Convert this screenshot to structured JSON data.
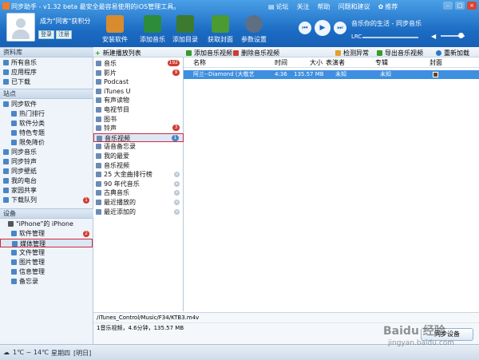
{
  "window": {
    "title": "同步助手 - v1.32 beta  最安全最容易使用的iOS管理工具。",
    "top_links": [
      "论坛",
      "关注",
      "帮助",
      "问题和建议",
      "推荐"
    ]
  },
  "user": {
    "slogan": "成为\"同客\"获积分",
    "login_label": "登录",
    "register_label": "注册"
  },
  "toolbar": {
    "buttons": [
      {
        "label": "安装软件",
        "icon": "install-software-icon",
        "color": "#d88b2f"
      },
      {
        "label": "添加音乐",
        "icon": "add-music-icon",
        "color": "#2d8c3a"
      },
      {
        "label": "添加目录",
        "icon": "add-folder-icon",
        "color": "#3b7a2f"
      },
      {
        "label": "获取封面",
        "icon": "get-cover-icon",
        "color": "#4b9a32"
      },
      {
        "label": "参数设置",
        "icon": "settings-icon",
        "color": "#5e6f83"
      }
    ]
  },
  "player": {
    "prev": "⏮",
    "play": "▶",
    "next": "⏭",
    "song": "音乐你的生活 - 同步音乐",
    "lrc_label": "LRC",
    "volume_icon": "speaker-icon"
  },
  "sidebar": {
    "library_head": "资料库",
    "library_items": [
      {
        "label": "所有音乐",
        "icon": "music-icon"
      },
      {
        "label": "应用程序",
        "icon": "app-icon"
      },
      {
        "label": "已下载",
        "icon": "download-icon"
      }
    ],
    "site_head": "站点",
    "site_items": [
      {
        "label": "同步软件",
        "icon": "software-icon",
        "level": 0
      },
      {
        "label": "热门排行",
        "icon": "rank-icon",
        "level": 1
      },
      {
        "label": "软件分类",
        "icon": "category-icon",
        "level": 1
      },
      {
        "label": "特色专题",
        "icon": "topic-icon",
        "level": 1
      },
      {
        "label": "限免降价",
        "icon": "discount-icon",
        "level": 1
      },
      {
        "label": "同步音乐",
        "icon": "music-icon",
        "level": 0
      },
      {
        "label": "同步铃声",
        "icon": "ringtone-icon",
        "level": 0
      },
      {
        "label": "同步壁纸",
        "icon": "wallpaper-icon",
        "level": 0
      },
      {
        "label": "我的电台",
        "icon": "radio-icon",
        "level": 0
      },
      {
        "label": "家园共享",
        "icon": "share-icon",
        "level": 0
      },
      {
        "label": "下载队列",
        "icon": "queue-icon",
        "level": 0,
        "badge": "1"
      }
    ],
    "device_head": "设备",
    "device_name": "\"iPhone\"的 iPhone",
    "device_items": [
      {
        "label": "软件管理",
        "icon": "software-manage-icon",
        "badge": "2"
      },
      {
        "label": "媒体管理",
        "icon": "media-manage-icon",
        "selected": true
      },
      {
        "label": "文件管理",
        "icon": "file-manage-icon"
      },
      {
        "label": "图片管理",
        "icon": "photo-manage-icon"
      },
      {
        "label": "信息管理",
        "icon": "message-manage-icon"
      },
      {
        "label": "备忘录",
        "icon": "memo-icon"
      }
    ]
  },
  "playlists": {
    "new_label": "新建播放列表",
    "items": [
      {
        "label": "音乐",
        "count": "192",
        "icon": "music-note-icon"
      },
      {
        "label": "影片",
        "count": "9",
        "icon": "film-icon"
      },
      {
        "label": "Podcast",
        "icon": "podcast-icon"
      },
      {
        "label": "iTunes U",
        "icon": "itunes-u-icon"
      },
      {
        "label": "有声读物",
        "icon": "audiobook-icon"
      },
      {
        "label": "电视节目",
        "icon": "tv-icon"
      },
      {
        "label": "图书",
        "icon": "book-icon"
      },
      {
        "label": "铃声",
        "count": "3",
        "icon": "bell-icon"
      },
      {
        "label": "音乐视频",
        "count": "1",
        "icon": "music-video-icon",
        "selected": true
      },
      {
        "label": "语音备忘录",
        "icon": "voice-memo-icon"
      },
      {
        "label": "我的最爱",
        "icon": "favorite-icon"
      },
      {
        "label": "音乐视频",
        "icon": "playlist-icon"
      },
      {
        "label": "25 大金曲排行榜",
        "icon": "playlist-icon",
        "removable": true
      },
      {
        "label": "90 年代音乐",
        "icon": "playlist-icon",
        "removable": true
      },
      {
        "label": "古典音乐",
        "icon": "playlist-icon",
        "removable": true
      },
      {
        "label": "最近播放的",
        "icon": "playlist-icon",
        "removable": true
      },
      {
        "label": "最近添加的",
        "icon": "playlist-icon",
        "removable": true
      }
    ]
  },
  "content_toolbar": {
    "add_video": "添加音乐视频",
    "delete_video": "删除音乐视频",
    "detect_error": "检测异常",
    "export_video": "导出音乐视频",
    "refresh": "重新加载"
  },
  "table": {
    "columns": [
      "名称",
      "时间",
      "大小",
      "表演者",
      "专辑",
      "封面"
    ],
    "rows": [
      {
        "name": "阿兰--Diamond (大敬艺",
        "time": "4:36",
        "size": "135.57 MB",
        "artist": "未知",
        "album": "未知"
      }
    ]
  },
  "footer": {
    "path": "/iTunes_Control/Music/F34/KTB3.m4v",
    "summary": "1音乐视频，4.6分钟，135.57 MB",
    "sync_label": "同步设备"
  },
  "statusbar": {
    "weather": "1℃ ~ 14℃",
    "day": "星期四",
    "extra": "[明日]"
  },
  "watermark": {
    "text": "Baidu 经验",
    "sub": "jingyan.baidu.com"
  }
}
